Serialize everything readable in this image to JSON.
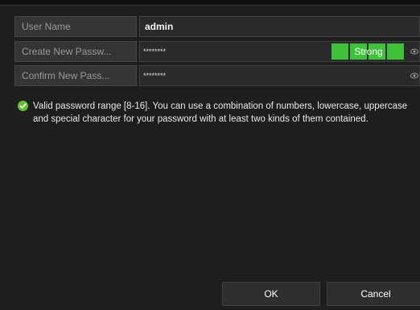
{
  "form": {
    "rows": [
      {
        "label": "User Name",
        "value": "admin"
      },
      {
        "label": "Create New Passw...",
        "value": "********"
      },
      {
        "label": "Confirm New Pass...",
        "value": "********"
      }
    ],
    "strength_label": "Strong",
    "strength_segments": 4
  },
  "hint": {
    "icon": "check-circle-icon",
    "text": "Valid password range [8-16]. You can use a combination of numbers, lowercase, uppercase and special character for your password with at least two kinds of them contained."
  },
  "buttons": {
    "ok": "OK",
    "cancel": "Cancel"
  },
  "colors": {
    "background": "#1e1e1e",
    "label_bg": "#353535",
    "strength_green": "#3ec23a",
    "hint_check": "#5fbf2e"
  },
  "icons": {
    "eye": "eye-icon",
    "check": "check-circle-icon"
  }
}
